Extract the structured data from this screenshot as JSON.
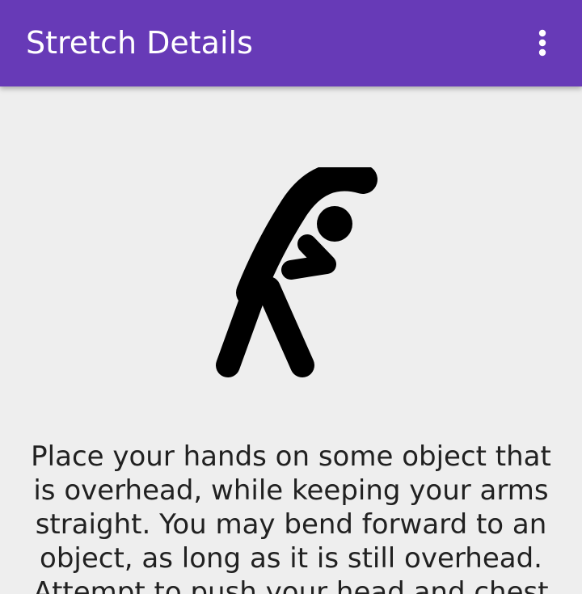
{
  "toolbar": {
    "title": "Stretch Details",
    "overflow_icon": "more-vert-icon"
  },
  "stretch": {
    "illustration_icon": "side-stretch-figure-icon",
    "description": "Place your hands on some object that is overhead, while keeping your arms straight. You may bend forward to an object, as long as it is still overhead. Attempt to push your head and chest"
  },
  "colors": {
    "primary": "#673ab7",
    "background": "#eeeeee",
    "icon": "#000000"
  }
}
